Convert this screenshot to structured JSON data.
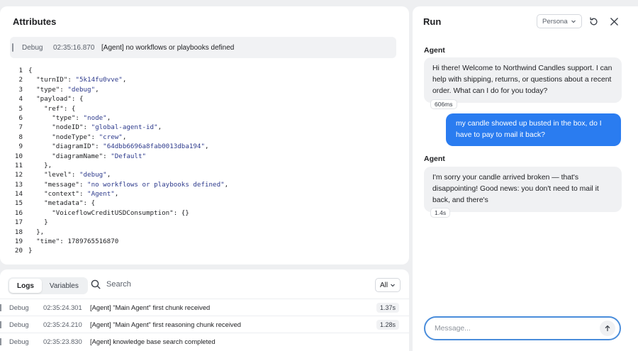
{
  "attributes": {
    "title": "Attributes",
    "banner": {
      "level": "Debug",
      "time": "02:35:16.870",
      "message": "[Agent] no workflows or playbooks defined"
    },
    "code_lines": [
      {
        "n": "1",
        "text": "{"
      },
      {
        "n": "2",
        "text": "  \"turnID\": \"5k14fu0vve\","
      },
      {
        "n": "3",
        "text": "  \"type\": \"debug\","
      },
      {
        "n": "4",
        "text": "  \"payload\": {"
      },
      {
        "n": "5",
        "text": "    \"ref\": {"
      },
      {
        "n": "6",
        "text": "      \"type\": \"node\","
      },
      {
        "n": "7",
        "text": "      \"nodeID\": \"global-agent-id\","
      },
      {
        "n": "8",
        "text": "      \"nodeType\": \"crew\","
      },
      {
        "n": "9",
        "text": "      \"diagramID\": \"64dbb6696a8fab0013dba194\","
      },
      {
        "n": "10",
        "text": "      \"diagramName\": \"Default\""
      },
      {
        "n": "11",
        "text": "    },"
      },
      {
        "n": "12",
        "text": "    \"level\": \"debug\","
      },
      {
        "n": "13",
        "text": "    \"message\": \"no workflows or playbooks defined\","
      },
      {
        "n": "14",
        "text": "    \"context\": \"Agent\","
      },
      {
        "n": "15",
        "text": "    \"metadata\": {"
      },
      {
        "n": "16",
        "text": "      \"VoiceflowCreditUSDConsumption\": {}"
      },
      {
        "n": "17",
        "text": "    }"
      },
      {
        "n": "18",
        "text": "  },"
      },
      {
        "n": "19",
        "text": "  \"time\": 1789765516870"
      },
      {
        "n": "20",
        "text": "}"
      }
    ]
  },
  "logs": {
    "tabs": [
      "Logs",
      "Variables"
    ],
    "active_tab": "Logs",
    "search_placeholder": "Search",
    "filter_value": "All",
    "rows": [
      {
        "level": "Debug",
        "time": "02:35:24.301",
        "message": "[Agent] \"Main Agent\" first chunk received",
        "duration": "1.37s"
      },
      {
        "level": "Debug",
        "time": "02:35:24.210",
        "message": "[Agent] \"Main Agent\" first reasoning chunk received",
        "duration": "1.28s"
      },
      {
        "level": "Debug",
        "time": "02:35:23.830",
        "message": "[Agent] knowledge base search completed",
        "duration": ""
      }
    ]
  },
  "run": {
    "title": "Run",
    "persona_label": "Persona",
    "messages": [
      {
        "sender": "Agent",
        "text": "Hi there! Welcome to Northwind Candles support. I can help with shipping, returns, or questions about a recent order. What can I do for you today?",
        "latency": "606ms"
      },
      {
        "sender": "user",
        "text": "my candle showed up busted in the box, do I have to pay to mail it back?"
      },
      {
        "sender": "Agent",
        "text": "I'm sorry your candle arrived broken — that's disappointing! Good news: you don't need to mail it back, and there's",
        "latency": "1.4s"
      }
    ],
    "input_placeholder": "Message...",
    "colors": {
      "user_bubble": "#2a7cf0",
      "input_border": "#4a8ddb"
    },
    "icons": [
      "chevron-down-icon",
      "refresh-icon",
      "close-icon",
      "send-arrow-icon",
      "search-icon"
    ]
  }
}
